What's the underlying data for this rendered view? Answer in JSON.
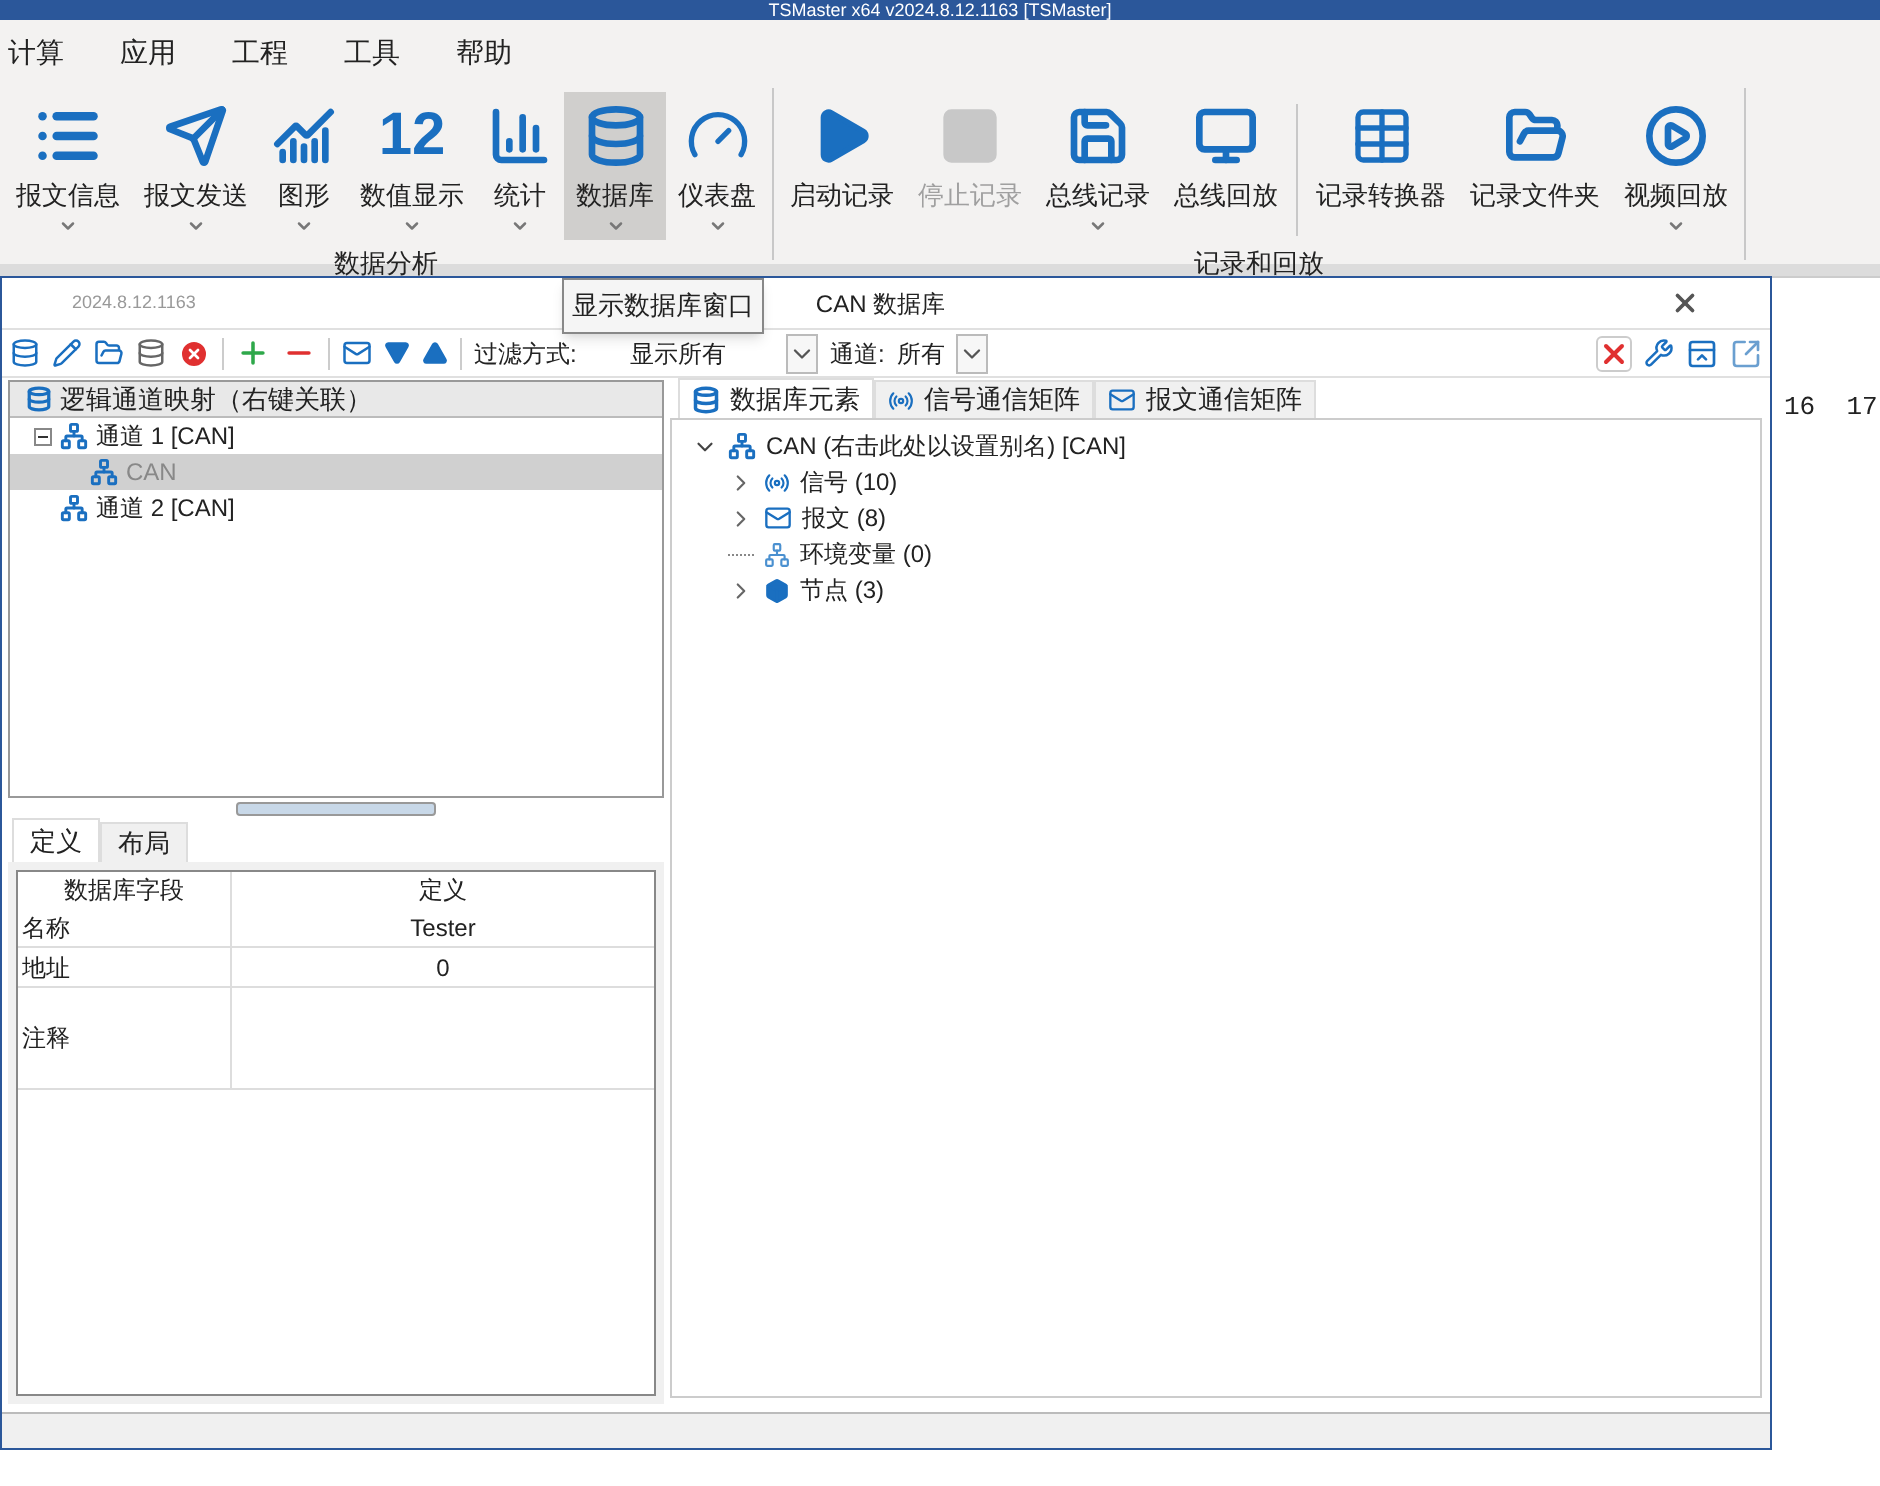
{
  "window": {
    "title": "TSMaster x64 v2024.8.12.1163 [TSMaster]"
  },
  "menu": [
    "计算",
    "应用",
    "工程",
    "工具",
    "帮助"
  ],
  "ribbon_groups": [
    {
      "label": "数据分析",
      "buttons": [
        {
          "label": "报文信息",
          "dropdown": true,
          "disabled": false,
          "selected": false
        },
        {
          "label": "报文发送",
          "dropdown": true,
          "disabled": false,
          "selected": false
        },
        {
          "label": "图形",
          "dropdown": true,
          "disabled": false,
          "selected": false
        },
        {
          "label": "数值显示",
          "dropdown": true,
          "disabled": false,
          "selected": false,
          "icon_text": "12"
        },
        {
          "label": "统计",
          "dropdown": true,
          "disabled": false,
          "selected": false
        },
        {
          "label": "数据库",
          "dropdown": true,
          "disabled": false,
          "selected": true
        },
        {
          "label": "仪表盘",
          "dropdown": true,
          "disabled": false,
          "selected": false
        }
      ]
    },
    {
      "label": "记录和回放",
      "buttons": [
        {
          "label": "启动记录",
          "dropdown": false,
          "disabled": false,
          "selected": false
        },
        {
          "label": "停止记录",
          "dropdown": false,
          "disabled": true,
          "selected": false
        },
        {
          "label": "总线记录",
          "dropdown": true,
          "disabled": false,
          "selected": false
        },
        {
          "label": "总线回放",
          "dropdown": false,
          "disabled": false,
          "selected": false
        },
        {
          "label": "记录转换器",
          "dropdown": false,
          "disabled": false,
          "selected": false
        },
        {
          "label": "记录文件夹",
          "dropdown": false,
          "disabled": false,
          "selected": false
        },
        {
          "label": "视频回放",
          "dropdown": true,
          "disabled": false,
          "selected": false
        }
      ]
    }
  ],
  "tooltip": "显示数据库窗口",
  "db_window": {
    "version": "2024.8.12.1163",
    "title": "CAN 数据库",
    "toolbar": {
      "filter_label": "过滤方式:",
      "filter_value": "显示所有",
      "channel_label": "通道:",
      "channel_value": "所有"
    },
    "mapping_tree": {
      "header": "逻辑通道映射（右键关联）",
      "items": [
        {
          "label": "通道 1 [CAN]",
          "expanded": true,
          "selected": false,
          "children": [
            {
              "label": "CAN",
              "selected": true
            }
          ]
        },
        {
          "label": "通道 2 [CAN]",
          "selected": false
        }
      ]
    },
    "bottom_tabs": [
      {
        "label": "定义",
        "selected": true
      },
      {
        "label": "布局",
        "selected": false
      }
    ],
    "table": {
      "columns": [
        "数据库字段",
        "定义"
      ],
      "rows": [
        [
          "名称",
          "Tester"
        ],
        [
          "地址",
          "0"
        ],
        [
          "注释",
          ""
        ]
      ]
    },
    "element_tabs": [
      {
        "label": "数据库元素",
        "selected": true
      },
      {
        "label": "信号通信矩阵",
        "selected": false
      },
      {
        "label": "报文通信矩阵",
        "selected": false
      }
    ],
    "element_tree": {
      "label": "CAN (右击此处以设置别名) [CAN]",
      "expanded": true,
      "children": [
        {
          "label": "信号 (10)",
          "expandable": true
        },
        {
          "label": "报文 (8)",
          "expandable": true
        },
        {
          "label": "环境变量 (0)",
          "expandable": false
        },
        {
          "label": "节点 (3)",
          "expandable": true
        }
      ]
    }
  },
  "background_text": "16  17"
}
